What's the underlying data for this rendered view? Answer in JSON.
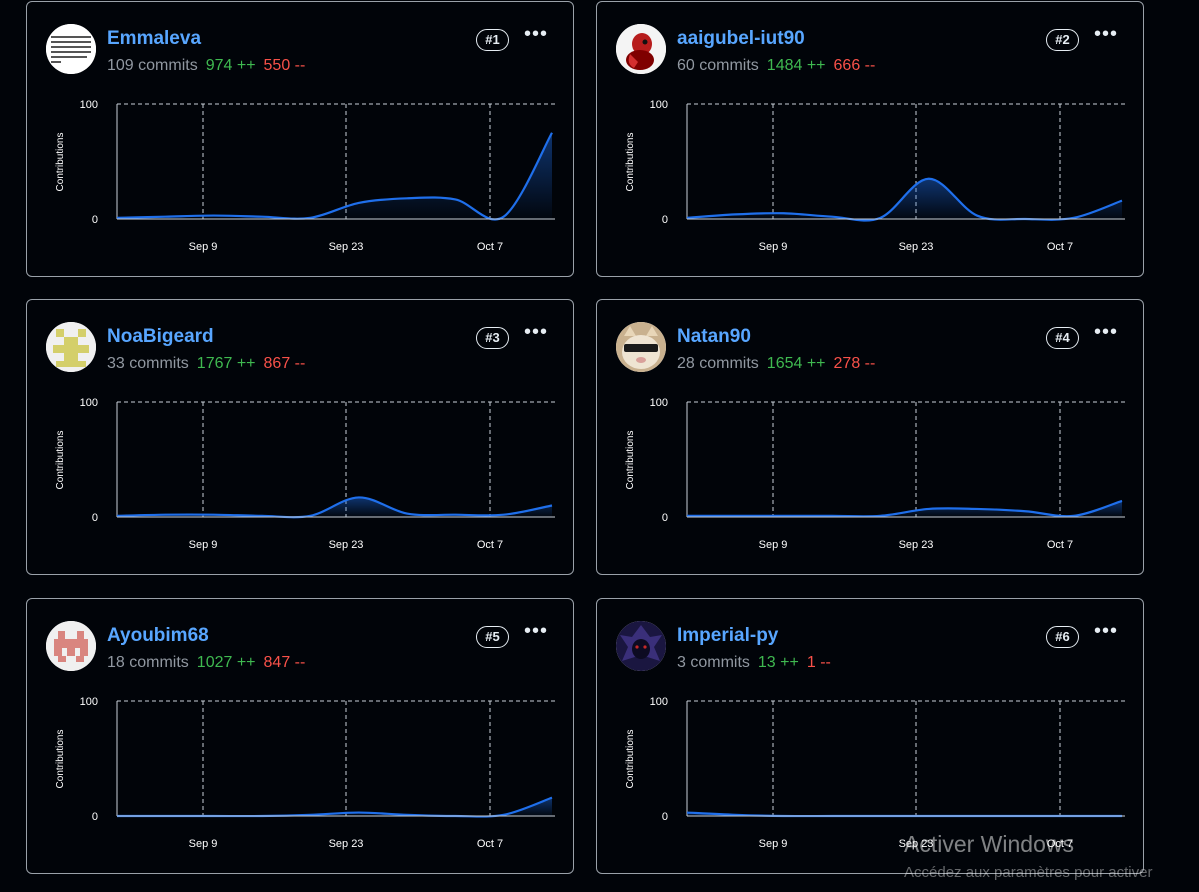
{
  "contributors": [
    {
      "rank": "#1",
      "name": "Emmaleva",
      "commits": "109 commits",
      "additions": "974 ++",
      "deletions": "550 --",
      "avatar_icon": "text-grid-avatar-icon"
    },
    {
      "rank": "#2",
      "name": "aaigubel-iut90",
      "commits": "60 commits",
      "additions": "1484 ++",
      "deletions": "666 --",
      "avatar_icon": "red-figure-avatar-icon"
    },
    {
      "rank": "#3",
      "name": "NoaBigeard",
      "commits": "33 commits",
      "additions": "1767 ++",
      "deletions": "867 --",
      "avatar_icon": "yellow-identicon-avatar-icon"
    },
    {
      "rank": "#4",
      "name": "Natan90",
      "commits": "28 commits",
      "additions": "1654 ++",
      "deletions": "278 --",
      "avatar_icon": "cat-sunglasses-avatar-icon"
    },
    {
      "rank": "#5",
      "name": "Ayoubim68",
      "commits": "18 commits",
      "additions": "1027 ++",
      "deletions": "847 --",
      "avatar_icon": "pink-identicon-avatar-icon"
    },
    {
      "rank": "#6",
      "name": "Imperial-py",
      "commits": "3 commits",
      "additions": "13 ++",
      "deletions": "1 --",
      "avatar_icon": "dark-character-avatar-icon"
    }
  ],
  "chart_data": [
    {
      "type": "area",
      "series": [
        {
          "values": [
            1,
            2,
            3,
            2,
            1,
            14,
            18,
            17,
            2,
            75
          ]
        }
      ],
      "x_ticks": [
        "Sep 9",
        "Sep 23",
        "Oct 7"
      ],
      "ylabel": "Contributions",
      "y_ticks": [
        "0",
        "100"
      ],
      "ylim": [
        0,
        100
      ]
    },
    {
      "type": "area",
      "series": [
        {
          "values": [
            1,
            4,
            5,
            2,
            1,
            35,
            3,
            0,
            1,
            16
          ]
        }
      ],
      "x_ticks": [
        "Sep 9",
        "Sep 23",
        "Oct 7"
      ],
      "ylabel": "Contributions",
      "y_ticks": [
        "0",
        "100"
      ],
      "ylim": [
        0,
        100
      ]
    },
    {
      "type": "area",
      "series": [
        {
          "values": [
            1,
            2,
            2,
            1,
            1,
            17,
            3,
            2,
            2,
            10
          ]
        }
      ],
      "x_ticks": [
        "Sep 9",
        "Sep 23",
        "Oct 7"
      ],
      "ylabel": "Contributions",
      "y_ticks": [
        "0",
        "100"
      ],
      "ylim": [
        0,
        100
      ]
    },
    {
      "type": "area",
      "series": [
        {
          "values": [
            1,
            1,
            1,
            1,
            1,
            7,
            7,
            5,
            1,
            14
          ]
        }
      ],
      "x_ticks": [
        "Sep 9",
        "Sep 23",
        "Oct 7"
      ],
      "ylabel": "Contributions",
      "y_ticks": [
        "0",
        "100"
      ],
      "ylim": [
        0,
        100
      ]
    },
    {
      "type": "area",
      "series": [
        {
          "values": [
            0,
            0,
            0,
            0,
            1,
            3,
            1,
            0,
            1,
            16
          ]
        }
      ],
      "x_ticks": [
        "Sep 9",
        "Sep 23",
        "Oct 7"
      ],
      "ylabel": "Contributions",
      "y_ticks": [
        "0",
        "100"
      ],
      "ylim": [
        0,
        100
      ]
    },
    {
      "type": "area",
      "series": [
        {
          "values": [
            3,
            1,
            0,
            0,
            0,
            0,
            0,
            0,
            0,
            0
          ]
        }
      ],
      "x_ticks": [
        "Sep 9",
        "Sep 23",
        "Oct 7"
      ],
      "ylabel": "Contributions",
      "y_ticks": [
        "0",
        "100"
      ],
      "ylim": [
        0,
        100
      ]
    }
  ],
  "watermark": {
    "title": "Activer Windows",
    "subtitle": "Accédez aux paramètres pour activer"
  },
  "colors": {
    "line": "#1f6feb",
    "link": "#58a6ff",
    "additions": "#3fb950",
    "deletions": "#f85149",
    "background": "#010409"
  }
}
